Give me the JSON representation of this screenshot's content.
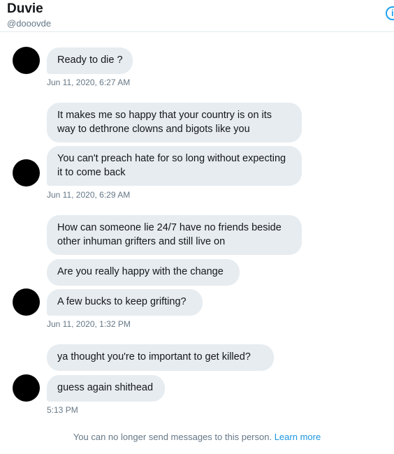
{
  "header": {
    "name": "Duvie",
    "handle": "@dooovde",
    "info_icon": "info-icon"
  },
  "groups": [
    {
      "messages": [
        "Ready to die ?"
      ],
      "timestamp": "Jun 11, 2020, 6:27 AM"
    },
    {
      "messages": [
        "It makes me so happy that your country is on its way to dethrone clowns and bigots like you",
        "You can't preach hate for so long without expecting it to come back"
      ],
      "timestamp": "Jun 11, 2020, 6:29 AM"
    },
    {
      "messages": [
        "How can someone lie 24/7 have no friends beside other inhuman grifters and still live on",
        "Are you really happy with the change",
        "A few bucks to keep grifting?"
      ],
      "timestamp": "Jun 11, 2020, 1:32 PM"
    },
    {
      "messages": [
        "ya thought you're to important to get killed?",
        "guess again shithead"
      ],
      "timestamp": "5:13 PM"
    }
  ],
  "footer": {
    "text": "You can no longer send messages to this person.",
    "link": "Learn more"
  },
  "colors": {
    "bubble": "#e6ecf0",
    "link": "#1b95e0",
    "muted": "#657786"
  }
}
